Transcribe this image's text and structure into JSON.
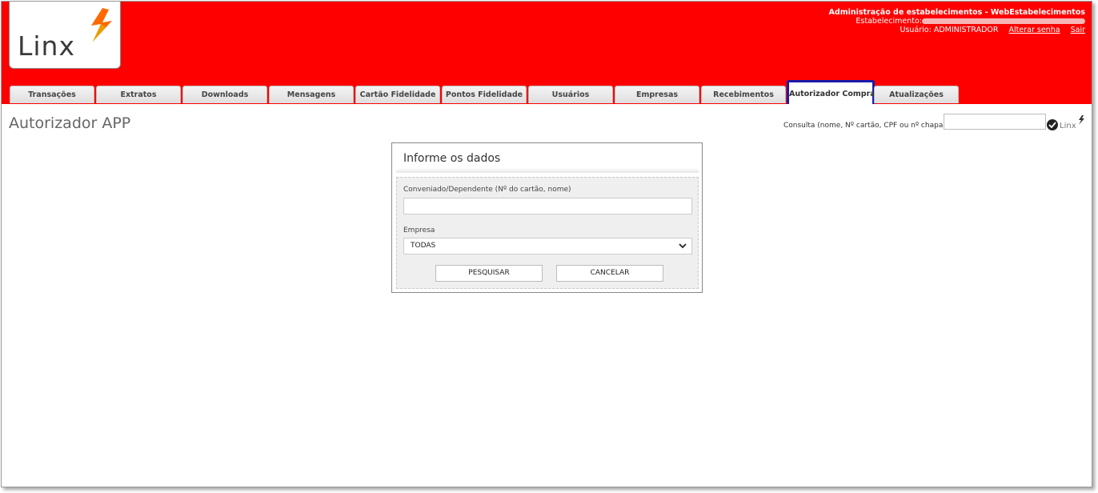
{
  "logo": {
    "text": "Linx"
  },
  "header": {
    "title": "Administração de estabelecimentos - WebEstabelecimentos",
    "estabelecimento_label": "Estabelecimento:",
    "usuario_label": "Usuário: ADMINISTRADOR",
    "alterar_senha": "Alterar senha",
    "sair": "Sair"
  },
  "tabs": [
    {
      "label": "Transações"
    },
    {
      "label": "Extratos"
    },
    {
      "label": "Downloads"
    },
    {
      "label": "Mensagens"
    },
    {
      "label": "Cartão Fidelidade"
    },
    {
      "label": "Pontos Fidelidade"
    },
    {
      "label": "Usuários"
    },
    {
      "label": "Empresas"
    },
    {
      "label": "Recebimentos"
    },
    {
      "label": "Autorizador Compras",
      "active": true
    },
    {
      "label": "Atualizações"
    }
  ],
  "page": {
    "title": "Autorizador APP"
  },
  "consulta": {
    "label": "Consulta (nome, Nº cartão, CPF ou nº chapa)",
    "value": ""
  },
  "mini_logo": {
    "text": "Linx"
  },
  "form": {
    "title": "Informe os dados",
    "conveniado_label": "Conveniado/Dependente (Nº do cartão, nome)",
    "conveniado_value": "",
    "empresa_label": "Empresa",
    "empresa_selected": "TODAS",
    "pesquisar_label": "PESQUISAR",
    "cancelar_label": "CANCELAR"
  },
  "colors": {
    "header_bg": "#ff0000",
    "active_tab_border": "#1a1aa8",
    "logo_orange": "#ff6a00"
  }
}
